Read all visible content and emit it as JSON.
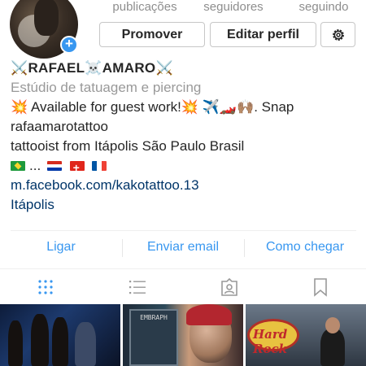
{
  "stats": {
    "posts_label": "publicações",
    "followers_label": "seguidores",
    "following_label": "seguindo"
  },
  "buttons": {
    "promote": "Promover",
    "edit_profile": "Editar perfil",
    "settings_icon": "gear-icon"
  },
  "profile": {
    "name": "⚔️RAFAEL☠️AMARO⚔️",
    "category": "Estúdio de tatuagem e piercing",
    "bio_line1": "💥 Available for guest work!💥 ✈️🏎️🙌🏽. Snap",
    "bio_line2": "rafaamarotattoo",
    "bio_line3": "tattooist from Itápolis São Paulo Brasil",
    "flags_text": "...",
    "link": "m.facebook.com/kakotattoo.13",
    "location": "Itápolis"
  },
  "actions": {
    "call": "Ligar",
    "email": "Enviar email",
    "directions": "Como chegar"
  },
  "grid": {
    "post2_text": "EMBRAPH",
    "post3_text": "Hard Rock"
  },
  "colors": {
    "accent": "#3897f0",
    "link": "#003569",
    "muted": "#999999"
  }
}
